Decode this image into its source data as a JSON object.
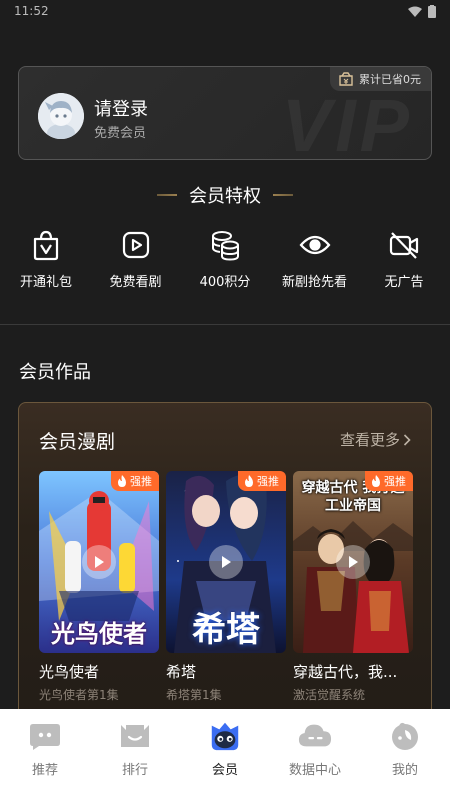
{
  "status_bar": {
    "time": "11:52"
  },
  "member_card": {
    "login_title": "请登录",
    "login_subtitle": "免费会员",
    "saved_text": "累计已省0元",
    "watermark": "VIP"
  },
  "privileges": {
    "heading": "会员特权",
    "items": [
      {
        "label": "开通礼包",
        "icon": "gift-bag-icon"
      },
      {
        "label": "免费看剧",
        "icon": "play-icon"
      },
      {
        "label": "400积分",
        "icon": "coins-icon"
      },
      {
        "label": "新剧抢先看",
        "icon": "eye-icon"
      },
      {
        "label": "无广告",
        "icon": "no-video-icon"
      }
    ]
  },
  "works_section": {
    "title": "会员作品",
    "card_title": "会员漫剧",
    "more_label": "查看更多",
    "hot_badge": "强推",
    "dramas": [
      {
        "title": "光鸟使者",
        "subtitle": "光鸟使者第1集",
        "poster_text": "光鸟使者"
      },
      {
        "title": "希塔",
        "subtitle": "希塔第1集",
        "poster_text": "希塔"
      },
      {
        "title": "穿越古代，我...",
        "subtitle": "激活觉醒系统",
        "poster_text": "穿越古代 我打造工业帝国"
      }
    ]
  },
  "tab_bar": {
    "tabs": [
      {
        "label": "推荐",
        "icon": "recommend-icon",
        "active": false
      },
      {
        "label": "排行",
        "icon": "ranking-icon",
        "active": false
      },
      {
        "label": "会员",
        "icon": "member-icon",
        "active": true
      },
      {
        "label": "数据中心",
        "icon": "data-center-icon",
        "active": false
      },
      {
        "label": "我的",
        "icon": "profile-icon",
        "active": false
      }
    ]
  },
  "colors": {
    "background": "#1d1d1d",
    "gold_border": "#6b573c",
    "hot_badge": "#ff6a2a",
    "member_tab": "#3b6df2"
  }
}
